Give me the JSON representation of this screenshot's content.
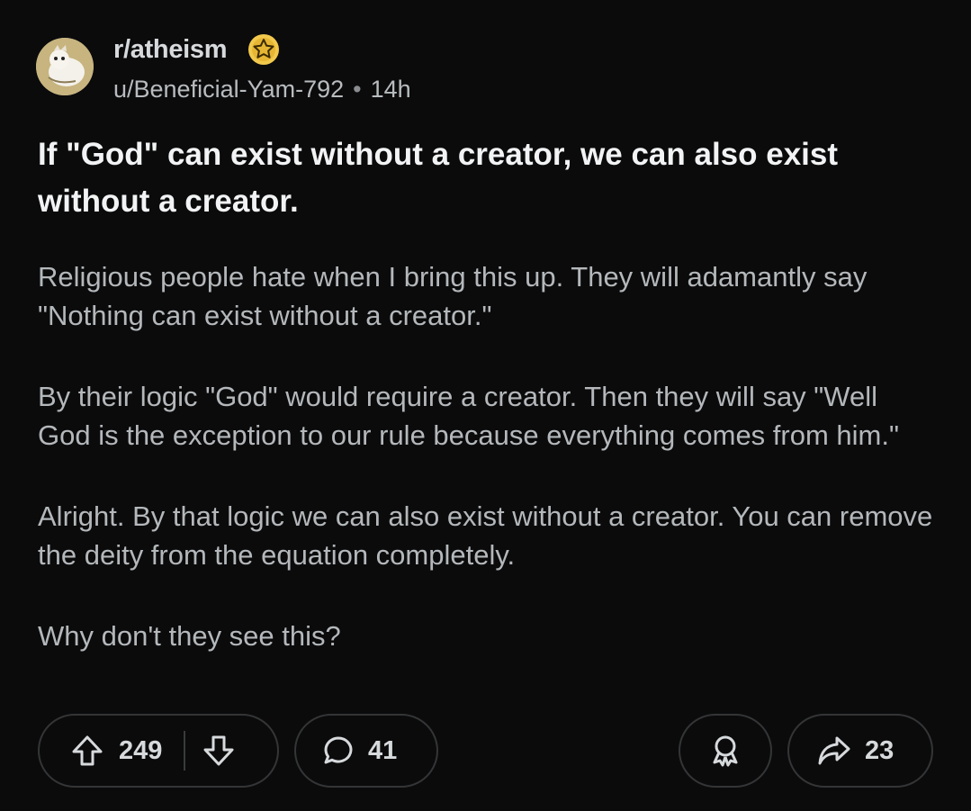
{
  "header": {
    "subreddit": "r/atheism",
    "username": "u/Beneficial-Yam-792",
    "separator": "•",
    "time": "14h"
  },
  "post": {
    "title": "If \"God\" can exist without a creator, we can also exist without a creator.",
    "paragraphs": [
      "Religious people hate when I bring this up. They will adamantly say \"Nothing can exist without a creator.\"",
      "By their logic \"God\" would require a creator. Then they will say \"Well God is the exception to our rule because everything comes from him.\"",
      "Alright. By that logic we can also exist without a creator. You can remove the deity from the equation completely.",
      "Why don't they see this?"
    ]
  },
  "actions": {
    "upvotes": "249",
    "comments": "41",
    "shares": "23"
  },
  "colors": {
    "background": "#0b0b0c",
    "award_gold": "#f2c94c"
  }
}
